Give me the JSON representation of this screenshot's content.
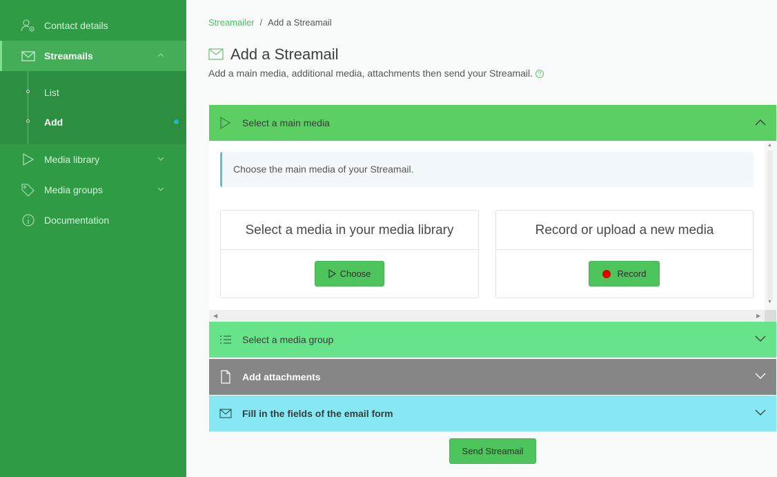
{
  "sidebar": {
    "items": [
      {
        "label": "Contact details",
        "icon": "user-settings-icon"
      },
      {
        "label": "Streamails",
        "icon": "envelope-icon",
        "active": true,
        "expanded": true
      },
      {
        "label": "Media library",
        "icon": "play-icon"
      },
      {
        "label": "Media groups",
        "icon": "tags-icon"
      },
      {
        "label": "Documentation",
        "icon": "info-icon"
      }
    ],
    "subitems": [
      {
        "label": "List"
      },
      {
        "label": "Add",
        "active": true
      }
    ]
  },
  "breadcrumb": {
    "root": "Streamailer",
    "separator": "/",
    "current": "Add a Streamail"
  },
  "page": {
    "title": "Add a Streamail",
    "subtitle": "Add a main media, additional media, attachments then send your Streamail."
  },
  "accordion": [
    {
      "label": "Select a main media",
      "expanded": true,
      "color": "#5bcf62"
    },
    {
      "label": "Select a media group",
      "expanded": false,
      "color": "#67e38a"
    },
    {
      "label": "Add attachments",
      "expanded": false,
      "color": "#868686"
    },
    {
      "label": "Fill in the fields of the email form",
      "expanded": false,
      "color": "#86e8f3"
    }
  ],
  "main_media": {
    "info": "Choose the main media of your Streamail.",
    "library_card": {
      "title": "Select a media in your media library",
      "button": "Choose"
    },
    "record_card": {
      "title": "Record or upload a new media",
      "button": "Record"
    }
  },
  "actions": {
    "send_label": "Send Streamail"
  },
  "colors": {
    "sidebar": "#2f9c45",
    "accent": "#4ec45d",
    "link": "#4ebf62",
    "record": "#e00000"
  }
}
